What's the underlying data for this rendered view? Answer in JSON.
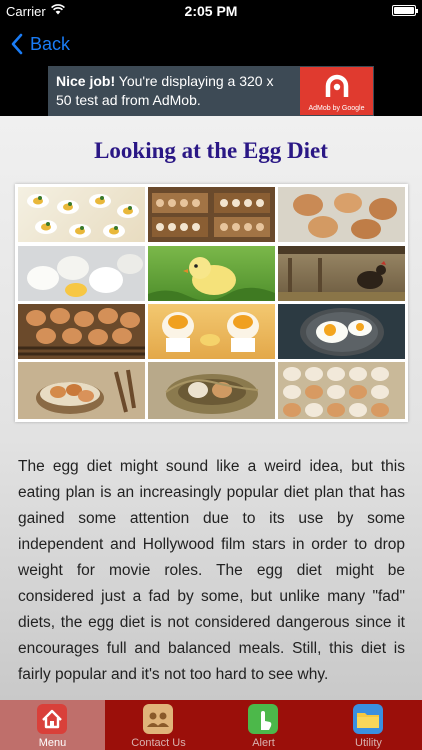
{
  "status_bar": {
    "carrier": "Carrier",
    "time": "2:05 PM"
  },
  "nav": {
    "back_label": "Back"
  },
  "ad": {
    "headline": "Nice job!",
    "body": "You're displaying a 320 x 50 test ad from AdMob.",
    "logo_caption": "AdMob by Google"
  },
  "page": {
    "title": "Looking at the Egg Diet",
    "body": "The egg diet might sound like a weird idea, but this eating plan is an increasingly popular diet plan that has gained some attention due to its use by some independent and Hollywood film stars in order to drop weight for movie roles. The egg diet might be considered just a fad by some, but unlike many \"fad\" diets, the egg diet is not considered dangerous since it encourages full and balanced meals. Still, this diet is fairly popular and it's not too hard to see why."
  },
  "collage_icons": [
    "deviled-eggs",
    "egg-crates",
    "brown-eggs",
    "white-eggs",
    "baby-chick",
    "hen",
    "egg-basket",
    "soft-boiled-eggs",
    "fried-egg-pan",
    "eggs-in-bowl",
    "eggs-in-nest",
    "egg-tray"
  ],
  "tab_bar": {
    "items": [
      {
        "label": "Menu",
        "icon": "home-icon",
        "color": "#d9403a",
        "active": true
      },
      {
        "label": "Contact Us",
        "icon": "contact-icon",
        "color": "#e0b47a",
        "active": false
      },
      {
        "label": "Alert",
        "icon": "hand-tap-icon",
        "color": "#4cb84a",
        "active": false
      },
      {
        "label": "Utility",
        "icon": "folder-icon",
        "color": "#3a8fe0",
        "active": false
      }
    ]
  },
  "colors": {
    "title": "#2a1785",
    "tab_bar": "#9b0f0a",
    "ad_background": "#3d4a55",
    "back_link": "#1a7cf5"
  }
}
